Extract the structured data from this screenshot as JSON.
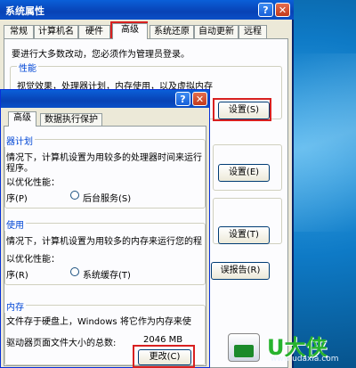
{
  "back_window": {
    "title": "系统属性",
    "help": "?",
    "close": "✕",
    "tabs": [
      "常规",
      "计算机名",
      "硬件",
      "高级",
      "系统还原",
      "自动更新",
      "远程"
    ],
    "intro": "要进行大多数改动，您必须作为管理员登录。",
    "perf_group": "性能",
    "perf_desc": "视觉效果，处理器计划，内存使用，以及虚拟内存",
    "settings_btn": "设置(S)",
    "settings_btn2": "设置(E)",
    "settings_btn3": "设置(T)",
    "error_btn": "误报告(R)"
  },
  "front_window": {
    "help": "?",
    "close": "✕",
    "tabs": [
      "高级",
      "数据执行保护"
    ],
    "proc_group": "器计划",
    "proc_desc1": "情况下，计算机设置为用较多的处理器时间来运行",
    "proc_desc2": "程序。",
    "proc_opt_label": "以优化性能：",
    "proc_radio1": "序(P)",
    "proc_radio2": "后台服务(S)",
    "mem_group": "使用",
    "mem_desc": "情况下，计算机设置为用较多的内存来运行您的程",
    "mem_opt_label": "以优化性能：",
    "mem_radio1": "序(R)",
    "mem_radio2": "系统缓存(T)",
    "vm_group": "内存",
    "vm_desc": "文件存于硬盘上，Windows 将它作为内存来使",
    "vm_total": "驱动器页面文件大小的总数:",
    "vm_size": "2046 MB",
    "change_btn": "更改(C)"
  },
  "logo": {
    "text": "U大侠",
    "url": "www.udaxia.com"
  }
}
